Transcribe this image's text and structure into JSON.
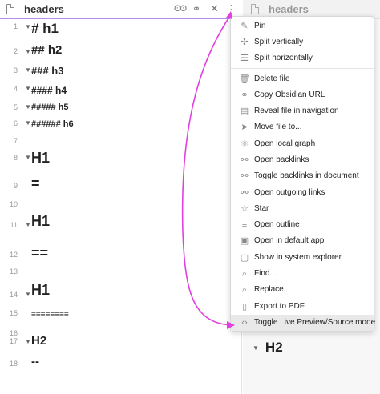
{
  "left_tab": {
    "title": "headers"
  },
  "right_tab": {
    "title": "headers"
  },
  "icons": {
    "file": "file-icon",
    "reading_view": "glasses-icon",
    "link": "link-icon",
    "close": "close-icon",
    "more": "more-options-icon"
  },
  "lines": [
    {
      "num": "1",
      "fold": true,
      "text": "# h1",
      "size": 17
    },
    {
      "num": "2",
      "fold": true,
      "text": "## h2",
      "size": 15
    },
    {
      "num": "3",
      "fold": true,
      "text": "### h3",
      "size": 13
    },
    {
      "num": "4",
      "fold": true,
      "text": "#### h4",
      "size": 12
    },
    {
      "num": "5",
      "fold": true,
      "text": "##### h5",
      "size": 11
    },
    {
      "num": "6",
      "fold": true,
      "text": "###### h6",
      "size": 11
    },
    {
      "num": "7",
      "fold": false,
      "text": "",
      "size": 11
    },
    {
      "num": "8",
      "fold": true,
      "text": "H1",
      "size": 18
    },
    {
      "num": "9",
      "fold": false,
      "text": "=",
      "size": 18
    },
    {
      "num": "10",
      "fold": false,
      "text": "",
      "size": 11
    },
    {
      "num": "11",
      "fold": true,
      "text": "H1",
      "size": 18
    },
    {
      "num": "12",
      "fold": false,
      "text": "==",
      "size": 18
    },
    {
      "num": "13",
      "fold": false,
      "text": "",
      "size": 11
    },
    {
      "num": "14",
      "fold": true,
      "text": "H1",
      "size": 18
    },
    {
      "num": "15",
      "fold": false,
      "text": "========",
      "size": 10
    },
    {
      "num": "16",
      "fold": false,
      "text": "",
      "size": 11
    },
    {
      "num": "17",
      "fold": true,
      "text": "H2",
      "size": 15
    },
    {
      "num": "18",
      "fold": false,
      "text": "--",
      "size": 15
    }
  ],
  "right_pane": {
    "heading": "H2"
  },
  "menu": {
    "items": [
      {
        "label": "Pin",
        "icon": "pin-icon",
        "glyph": "✎"
      },
      {
        "label": "Split vertically",
        "icon": "split-vertical-icon",
        "glyph": "✣"
      },
      {
        "label": "Split horizontally",
        "icon": "split-horizontal-icon",
        "glyph": "☰"
      },
      {
        "label": "Delete file",
        "icon": "trash-icon",
        "glyph": "🗑"
      },
      {
        "label": "Copy Obsidian URL",
        "icon": "link-icon",
        "glyph": "⚭"
      },
      {
        "label": "Reveal file in navigation",
        "icon": "document-icon",
        "glyph": "▤"
      },
      {
        "label": "Move file to...",
        "icon": "send-icon",
        "glyph": "➤"
      },
      {
        "label": "Open local graph",
        "icon": "graph-icon",
        "glyph": "⚛"
      },
      {
        "label": "Open backlinks",
        "icon": "backlinks-icon",
        "glyph": "⚯"
      },
      {
        "label": "Toggle backlinks in document",
        "icon": "backlinks-doc-icon",
        "glyph": "⚯"
      },
      {
        "label": "Open outgoing links",
        "icon": "outgoing-links-icon",
        "glyph": "⚯"
      },
      {
        "label": "Star",
        "icon": "star-icon",
        "glyph": "☆"
      },
      {
        "label": "Open outline",
        "icon": "outline-icon",
        "glyph": "≡"
      },
      {
        "label": "Open in default app",
        "icon": "open-app-icon",
        "glyph": "▣"
      },
      {
        "label": "Show in system explorer",
        "icon": "folder-icon",
        "glyph": "▢"
      },
      {
        "label": "Find...",
        "icon": "search-icon",
        "glyph": "⌕"
      },
      {
        "label": "Replace...",
        "icon": "replace-icon",
        "glyph": "⌕"
      },
      {
        "label": "Export to PDF",
        "icon": "pdf-icon",
        "glyph": "▯"
      },
      {
        "label": "Toggle Live Preview/Source mode",
        "icon": "code-icon",
        "glyph": "‹›"
      }
    ],
    "selected_index": 18
  },
  "annotation_color": "#e040e0"
}
